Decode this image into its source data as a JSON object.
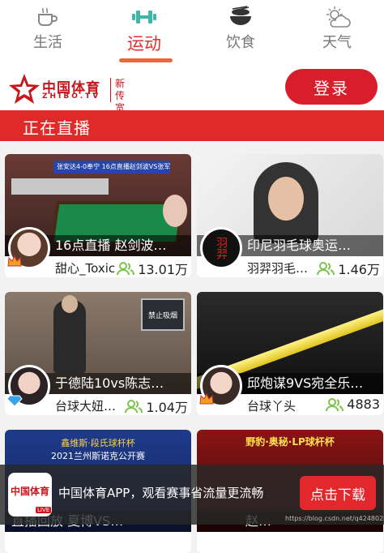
{
  "tabs": [
    {
      "label": "生活",
      "icon": "coffee-cup-icon"
    },
    {
      "label": "运动",
      "icon": "dumbbell-icon"
    },
    {
      "label": "饮食",
      "icon": "food-bowl-icon"
    },
    {
      "label": "天气",
      "icon": "weather-icon"
    }
  ],
  "header": {
    "logo_cn": "中国体育",
    "logo_en": "ZHIBO.TV",
    "logo_sub": "新传宽频",
    "login_label": "登录"
  },
  "section": {
    "title": "正在直播"
  },
  "cards": [
    {
      "title": "16点直播 赵剑波…",
      "streamer": "甜心_Toxic",
      "viewers": "13.01万",
      "thumb_top_text": "张安达4-0奉宁 16点直播赵剑波VS张军"
    },
    {
      "title": "印尼羽毛球奥运…",
      "streamer": "羽羿羽毛…",
      "viewers": "1.46万",
      "avatar_text": "羽羿"
    },
    {
      "title": "于德陆10vs陈志…",
      "streamer": "台球大妞…",
      "viewers": "1.04万",
      "thumb_sign": "禁止吸烟"
    },
    {
      "title": "邱炮谋9VS宛全乐…",
      "streamer": "台球丫头",
      "viewers": "4883"
    },
    {
      "title": "直播回放 夏博VS…",
      "streamer": "",
      "viewers": "",
      "thumb_top_text": "鑫维斯·段氏球杆杯",
      "thumb_sub_text": "2021兰州斯诺克公开赛"
    },
    {
      "title": "赵…",
      "streamer": "",
      "viewers": "",
      "thumb_top_text": "野豹·奥秘·LP球杆杯"
    }
  ],
  "banner": {
    "app_icon_text": "中国体育",
    "app_icon_badge": "LIVE",
    "text": "中国体育APP，观看赛事省流量更流畅",
    "button": "点击下载",
    "watermark": "https://blog.csdn.net/q4248028"
  },
  "colors": {
    "brand_red": "#d71e2a",
    "accent_orange": "#e36c3a",
    "viewer_icon_green": "#7cc44b"
  }
}
